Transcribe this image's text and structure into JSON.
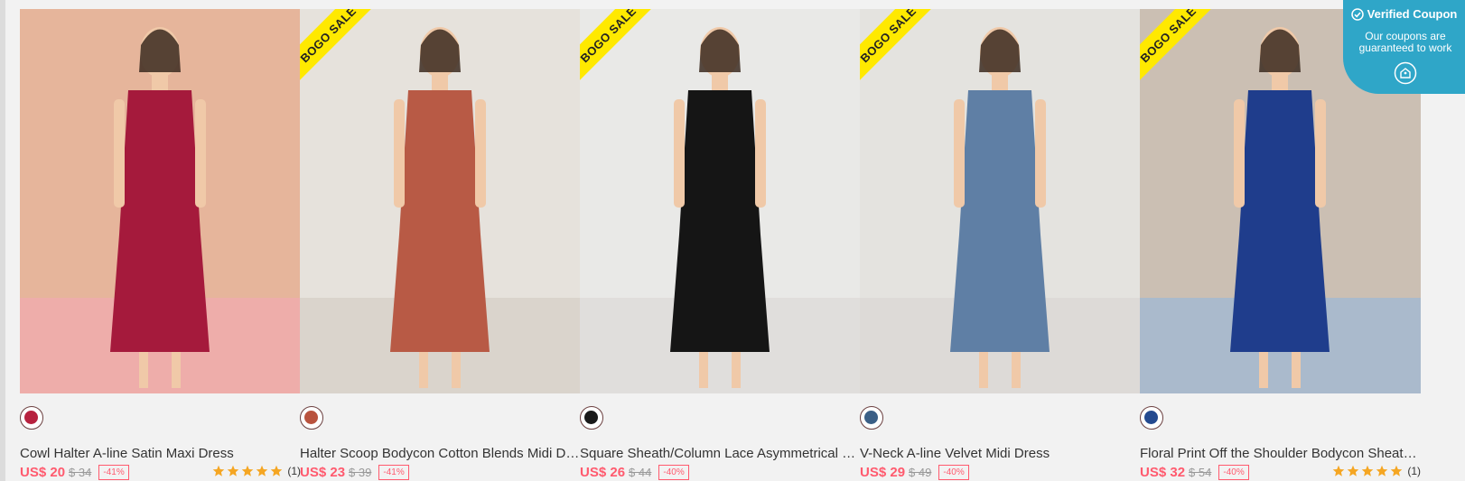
{
  "products": [
    {
      "title": "Cowl Halter A-line Satin Maxi Dress",
      "price": "US$ 20",
      "original_price": "$ 34",
      "discount": "-41%",
      "bogo": "",
      "swatch_color": "#b7223f",
      "rating_count": "(1)",
      "stars": 5,
      "bg_color": "#e6b59b",
      "dress_color": "#a51a3c",
      "accent_color": "#f4a6b7"
    },
    {
      "title": "Halter Scoop Bodycon Cotton Blends Midi Dre...",
      "price": "US$ 23",
      "original_price": "$ 39",
      "discount": "-41%",
      "bogo": "BOGO SALE",
      "swatch_color": "#b9533e",
      "rating_count": "",
      "stars": 0,
      "bg_color": "#e6e2dc",
      "dress_color": "#b85a45",
      "accent_color": "#cfc8bf"
    },
    {
      "title": "Square Sheath/Column Lace Asymmetrical Mi...",
      "price": "US$ 26",
      "original_price": "$ 44",
      "discount": "-40%",
      "bogo": "BOGO SALE",
      "swatch_color": "#1a1a1a",
      "rating_count": "",
      "stars": 0,
      "bg_color": "#e9e9e7",
      "dress_color": "#151515",
      "accent_color": "#d8d6d3"
    },
    {
      "title": "V-Neck A-line Velvet Midi Dress",
      "price": "US$ 29",
      "original_price": "$ 49",
      "discount": "-40%",
      "bogo": "BOGO SALE",
      "swatch_color": "#3b5f86",
      "rating_count": "",
      "stars": 0,
      "bg_color": "#e4e3df",
      "dress_color": "#5f7fa5",
      "accent_color": "#d7d4cf"
    },
    {
      "title": "Floral Print Off the Shoulder Bodycon Sheath/...",
      "price": "US$ 32",
      "original_price": "$ 54",
      "discount": "-40%",
      "bogo": "BOGO SALE",
      "swatch_color": "#244a8f",
      "rating_count": "(1)",
      "stars": 5,
      "bg_color": "#cbbfb3",
      "dress_color": "#1f3d8c",
      "accent_color": "#8fb6e0"
    }
  ],
  "coupon": {
    "title": "Verified Coupon",
    "subtitle": "Our coupons are guaranteed to work",
    "icon": "tag-icon"
  },
  "colors": {
    "price": "#ff5a6e",
    "star": "#f5a623",
    "badge": "#ffe900",
    "coupon_bg": "#2fa6c8"
  }
}
